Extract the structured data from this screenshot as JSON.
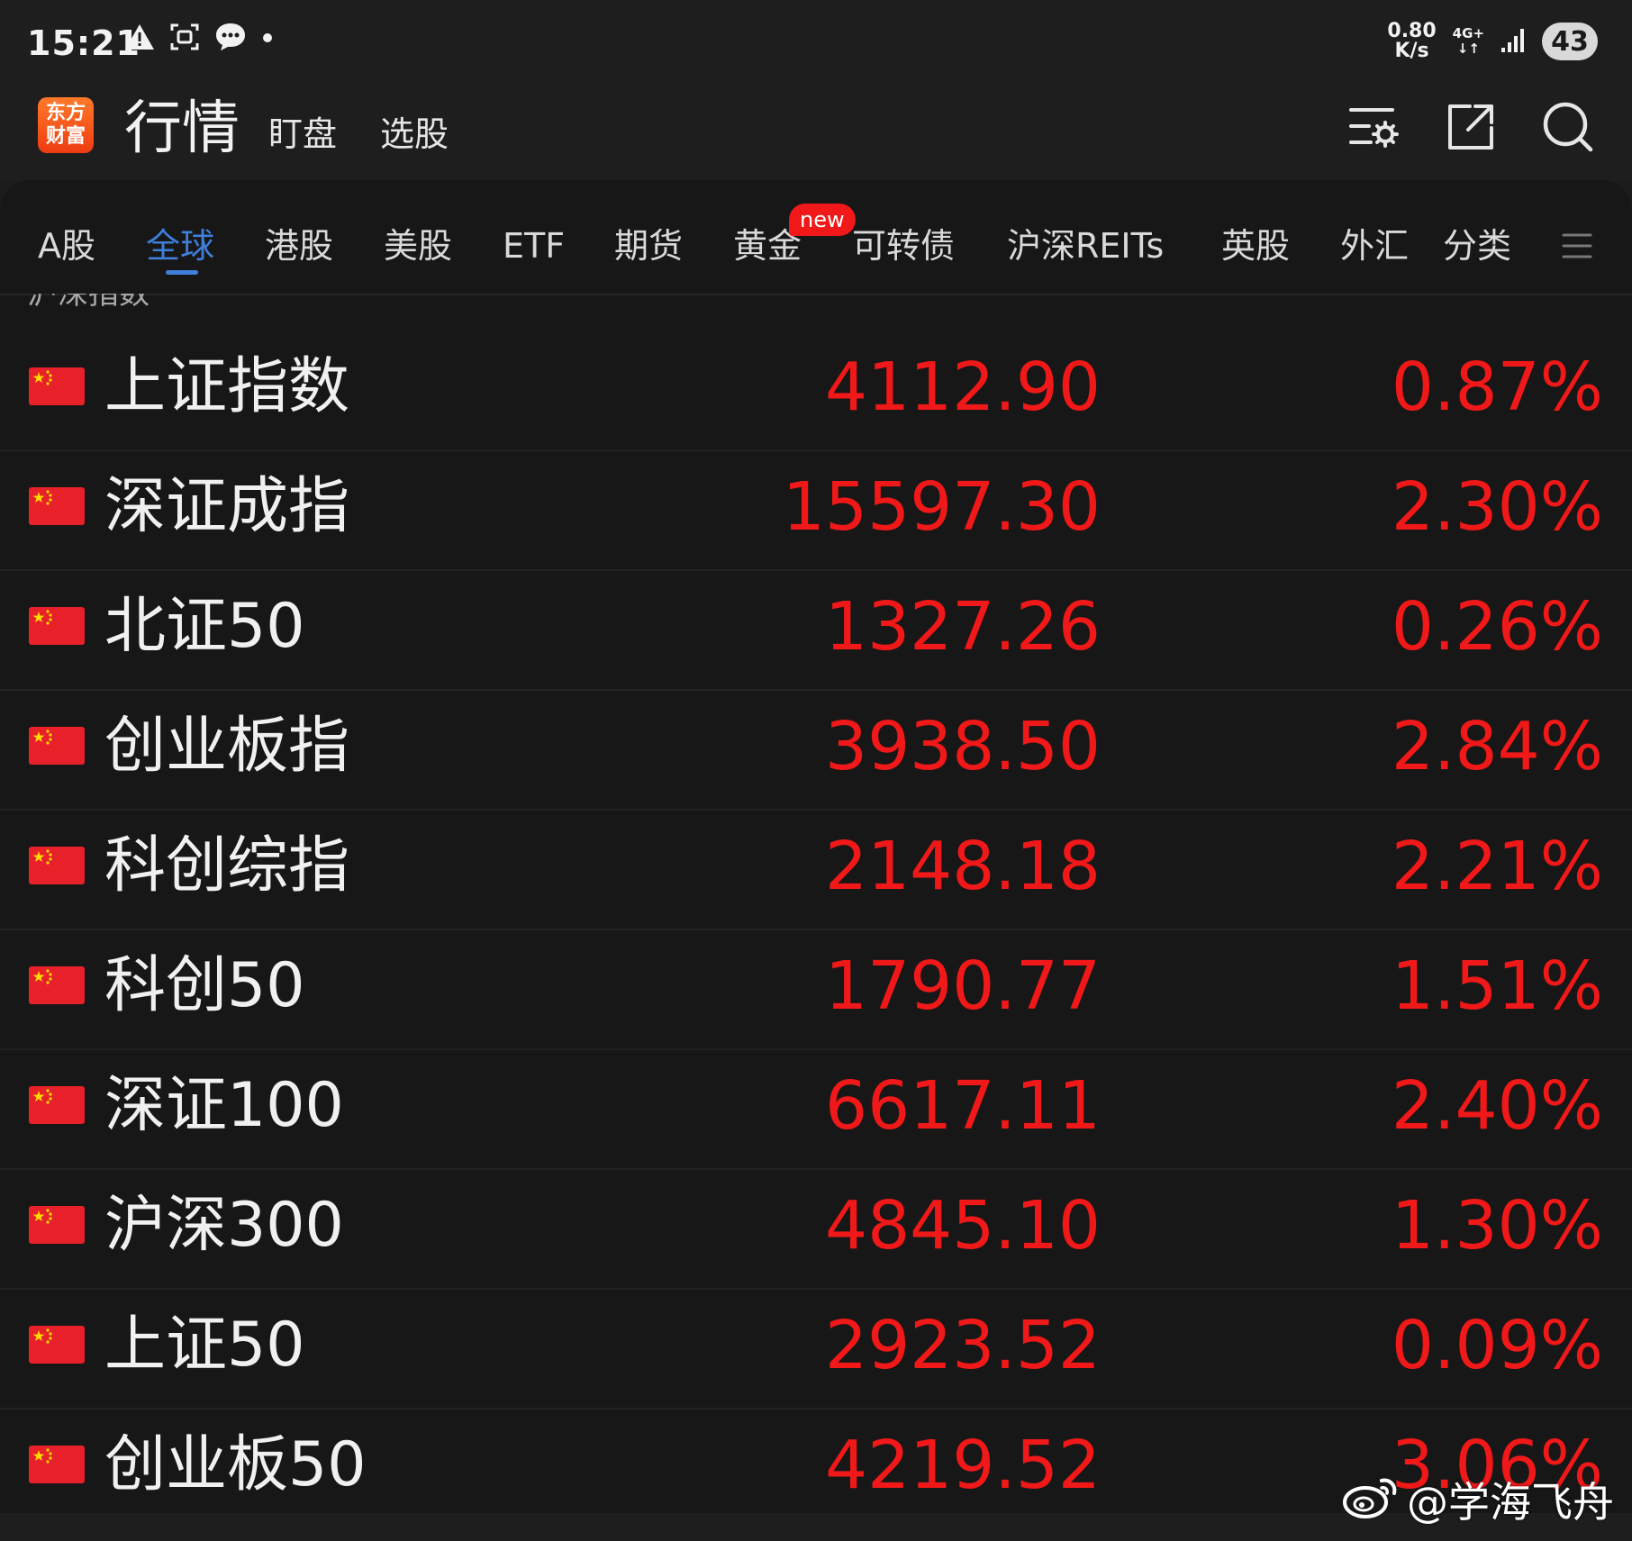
{
  "status_bar": {
    "time": "15:21",
    "net_speed_value": "0.80",
    "net_speed_unit": "K/s",
    "network_type": "4G+",
    "network_arrows": "↓↑",
    "battery": "43",
    "icons": [
      "warning-icon",
      "screenshot-icon",
      "chat-bubble-icon",
      "dot-icon",
      "signal-icon"
    ]
  },
  "header": {
    "logo_text": "东方\n财富",
    "title": "行情",
    "links": [
      "盯盘",
      "选股"
    ],
    "icons": [
      "list-settings-icon",
      "share-icon",
      "search-icon"
    ]
  },
  "tabs": {
    "items": [
      "A股",
      "全球",
      "港股",
      "美股",
      "ETF",
      "期货",
      "黄金",
      "可转债",
      "沪深REITs",
      "英股",
      "外汇",
      "分类"
    ],
    "active": "全球",
    "badge": "new",
    "menu_icon": "menu-icon"
  },
  "section_label": "沪深指数",
  "rows": [
    {
      "name": "上证指数",
      "price": "4112.90",
      "change": "0.87%"
    },
    {
      "name": "深证成指",
      "price": "15597.30",
      "change": "2.30%"
    },
    {
      "name": "北证50",
      "price": "1327.26",
      "change": "0.26%"
    },
    {
      "name": "创业板指",
      "price": "3938.50",
      "change": "2.84%"
    },
    {
      "name": "科创综指",
      "price": "2148.18",
      "change": "2.21%"
    },
    {
      "name": "科创50",
      "price": "1790.77",
      "change": "1.51%"
    },
    {
      "name": "深证100",
      "price": "6617.11",
      "change": "2.40%"
    },
    {
      "name": "沪深300",
      "price": "4845.10",
      "change": "1.30%"
    },
    {
      "name": "上证50",
      "price": "2923.52",
      "change": "0.09%"
    },
    {
      "name": "创业板50",
      "price": "4219.52",
      "change": "3.06%"
    }
  ],
  "colors": {
    "rise": "#f01818",
    "accent": "#3f7fd9",
    "background": "#171717"
  },
  "watermark": "@学海飞舟"
}
